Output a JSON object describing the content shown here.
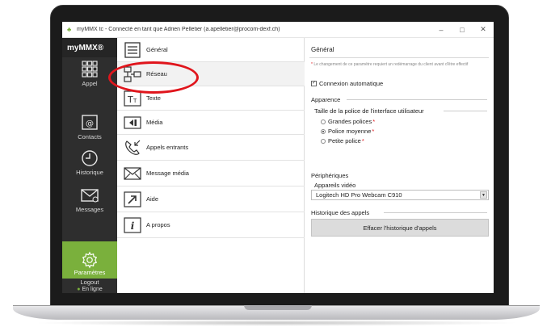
{
  "window": {
    "title": "myMMX tc - Connecté en tant que Adrien Pelletier (a.apelletier@procom-dexf.ch)",
    "minimize": "–",
    "maximize": "□",
    "close": "✕"
  },
  "nav": {
    "brand": "myMMX®",
    "items": [
      {
        "label": "Appel",
        "icon": "dialpad-icon"
      },
      {
        "label": "Contacts",
        "icon": "contacts-icon"
      },
      {
        "label": "Historique",
        "icon": "clock-icon"
      },
      {
        "label": "Messages",
        "icon": "mail-icon"
      }
    ],
    "settings_label": "Paramètres",
    "logout_label": "Logout",
    "status_label": "En ligne",
    "status_dot": "●"
  },
  "menu": {
    "items": [
      {
        "label": "Général",
        "icon": "list-icon"
      },
      {
        "label": "Réseau",
        "icon": "network-icon"
      },
      {
        "label": "Texte",
        "icon": "text-size-icon"
      },
      {
        "label": "Média",
        "icon": "media-icon"
      },
      {
        "label": "Appels entrants",
        "icon": "incoming-call-icon"
      },
      {
        "label": "Message média",
        "icon": "media-message-icon"
      },
      {
        "label": "Aide",
        "icon": "help-arrow-icon"
      },
      {
        "label": "A propos",
        "icon": "info-icon"
      }
    ]
  },
  "panel": {
    "title": "Général",
    "note_star": "*",
    "note": "Le changement de ce paramètre requiert un redémarrage du client avant d'être effectif",
    "auto_connect": "Connexion automatique",
    "appearance_title": "Apparence",
    "font_size_title": "Taille de la police de l'interface utilisateur",
    "radio_star": "*",
    "font_options": [
      "Grandes polices",
      "Police moyenne",
      "Petite police"
    ],
    "selected_font_option": "Police moyenne",
    "devices_title": "Périphériques",
    "video_devices_label": "Appareils vidéo",
    "video_device_value": "Logitech HD Pro Webcam C910",
    "history_title": "Historique des appels",
    "clear_history_button": "Effacer l'historique d'appels"
  },
  "colors": {
    "accent_green": "#7ab03c",
    "nav_dark": "#2e2e2e",
    "highlight_red": "#e0151c"
  }
}
